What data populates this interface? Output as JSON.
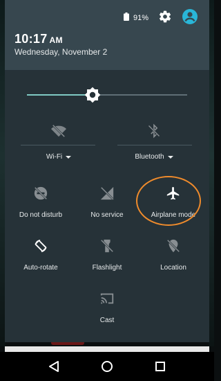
{
  "status": {
    "battery_percent": "91%",
    "icons": [
      "battery-icon",
      "settings-gear-icon",
      "account-icon"
    ],
    "accent_color": "#29b6d8"
  },
  "header": {
    "time": "10:17",
    "ampm": "AM",
    "date": "Wednesday, November 2"
  },
  "brightness": {
    "level_fraction": 0.41,
    "fill_color": "#80cbc4"
  },
  "dual_tiles": [
    {
      "label": "Wi-Fi",
      "icon": "wifi-off-icon",
      "has_dropdown": true
    },
    {
      "label": "Bluetooth",
      "icon": "bluetooth-off-icon",
      "has_dropdown": true
    }
  ],
  "tiles": [
    {
      "label": "Do not disturb",
      "icon": "do-not-disturb-icon",
      "active": false
    },
    {
      "label": "No service",
      "icon": "no-service-icon",
      "active": false
    },
    {
      "label": "Airplane mode",
      "icon": "airplane-icon",
      "active": true,
      "highlighted": true
    },
    {
      "label": "Auto-rotate",
      "icon": "auto-rotate-icon",
      "active": true
    },
    {
      "label": "Flashlight",
      "icon": "flashlight-icon",
      "active": false
    },
    {
      "label": "Location",
      "icon": "location-off-icon",
      "active": false
    },
    {
      "label": "Cast",
      "icon": "cast-icon",
      "active": false
    }
  ],
  "highlight_color": "#ef8b2c",
  "navbar": {
    "buttons": [
      "back-icon",
      "home-icon",
      "recents-icon"
    ]
  }
}
